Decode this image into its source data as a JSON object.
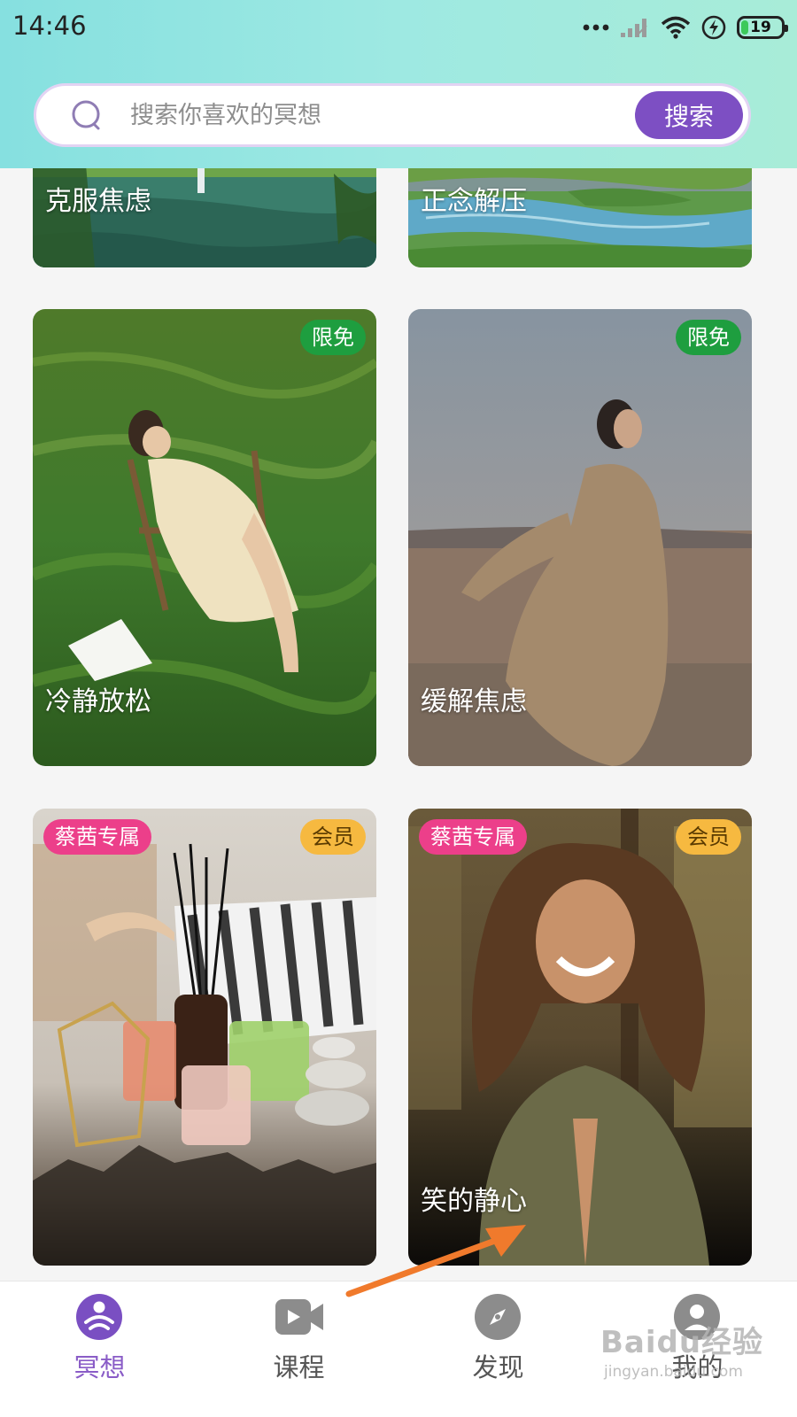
{
  "status_bar": {
    "time": "14:46",
    "battery_level": "19",
    "icons": [
      "more-dots-icon",
      "cellular-signal-icon",
      "wifi-icon",
      "charging-icon",
      "battery-icon"
    ]
  },
  "search": {
    "placeholder": "搜索你喜欢的冥想",
    "button_label": "搜索"
  },
  "cards": [
    {
      "title": "克服焦虑"
    },
    {
      "title": "正念解压"
    },
    {
      "title": "冷静放松",
      "badge": "限免"
    },
    {
      "title": "缓解焦虑",
      "badge": "限免"
    },
    {
      "title": "",
      "badge_left": "蔡茜专属",
      "badge_right": "会员"
    },
    {
      "title": "笑的静心",
      "badge_left": "蔡茜专属",
      "badge_right": "会员"
    }
  ],
  "bottom_nav": [
    {
      "label": "冥想",
      "icon": "meditation-icon",
      "active": true
    },
    {
      "label": "课程",
      "icon": "video-camera-icon",
      "active": false
    },
    {
      "label": "发现",
      "icon": "compass-icon",
      "active": false
    },
    {
      "label": "我的",
      "icon": "profile-icon",
      "active": false
    }
  ],
  "watermark": {
    "logo": "Baidu经验",
    "url": "jingyan.baidu.com"
  },
  "colors": {
    "accent": "#7d4fc3",
    "badge_free": "#1e9e3f",
    "badge_vip": "#f6b940",
    "badge_exclusive": "#ec3f8a",
    "annotation_arrow": "#f07a2c"
  }
}
